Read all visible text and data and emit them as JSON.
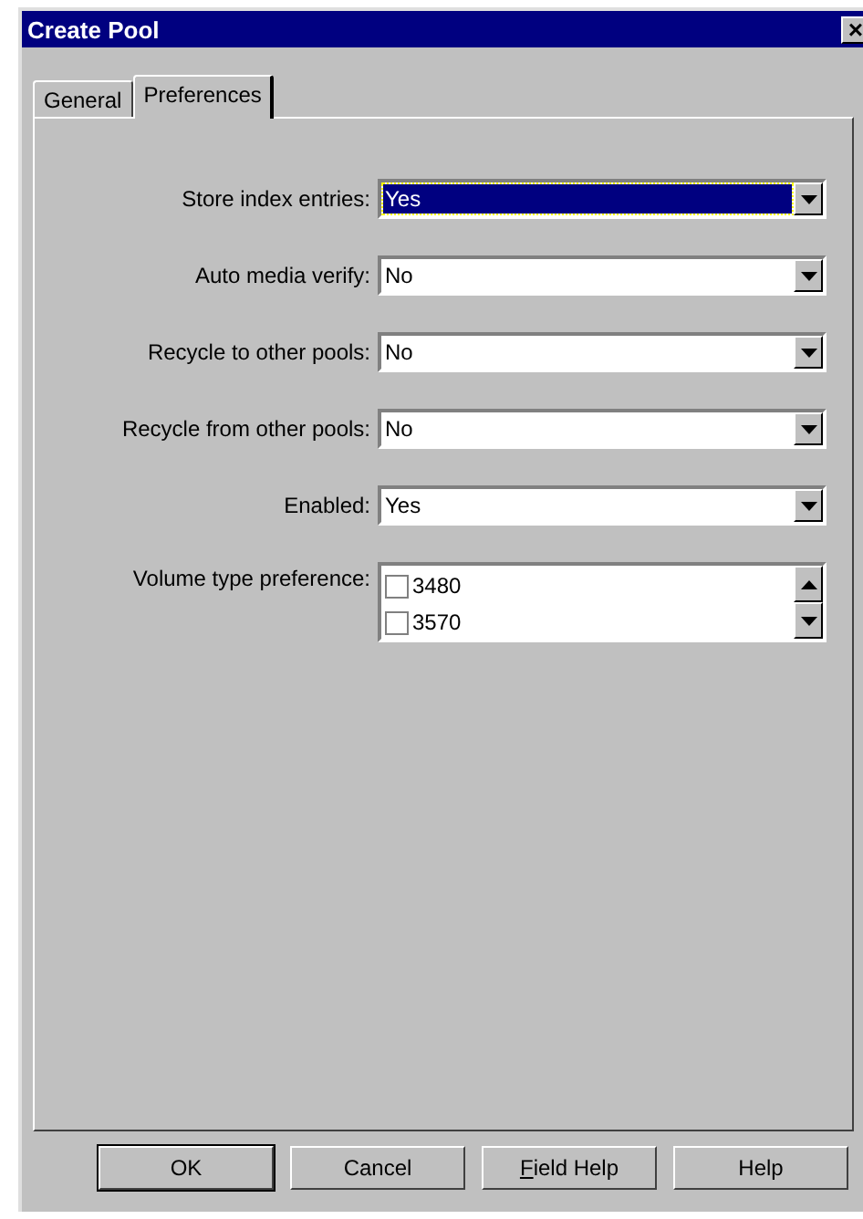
{
  "window": {
    "title": "Create Pool",
    "close": "×"
  },
  "tabs": [
    {
      "label": "General",
      "selected": false
    },
    {
      "label": "Preferences",
      "selected": true
    }
  ],
  "fields": [
    {
      "label": "Store index entries:",
      "value": "Yes",
      "focused": true
    },
    {
      "label": "Auto media verify:",
      "value": "No",
      "focused": false
    },
    {
      "label": "Recycle to other pools:",
      "value": "No",
      "focused": false
    },
    {
      "label": "Recycle from other pools:",
      "value": "No",
      "focused": false
    },
    {
      "label": "Enabled:",
      "value": "Yes",
      "focused": false
    }
  ],
  "volume_type": {
    "label": "Volume type preference:",
    "items": [
      {
        "label": "3480",
        "checked": false
      },
      {
        "label": "3570",
        "checked": false
      }
    ]
  },
  "buttons": [
    {
      "label": "OK",
      "mnemonic": false,
      "default": true
    },
    {
      "label": "Cancel",
      "mnemonic": false,
      "default": false
    },
    {
      "label": "Field Help",
      "mnemonic": true,
      "default": false
    },
    {
      "label": "Help",
      "mnemonic": false,
      "default": false
    }
  ]
}
